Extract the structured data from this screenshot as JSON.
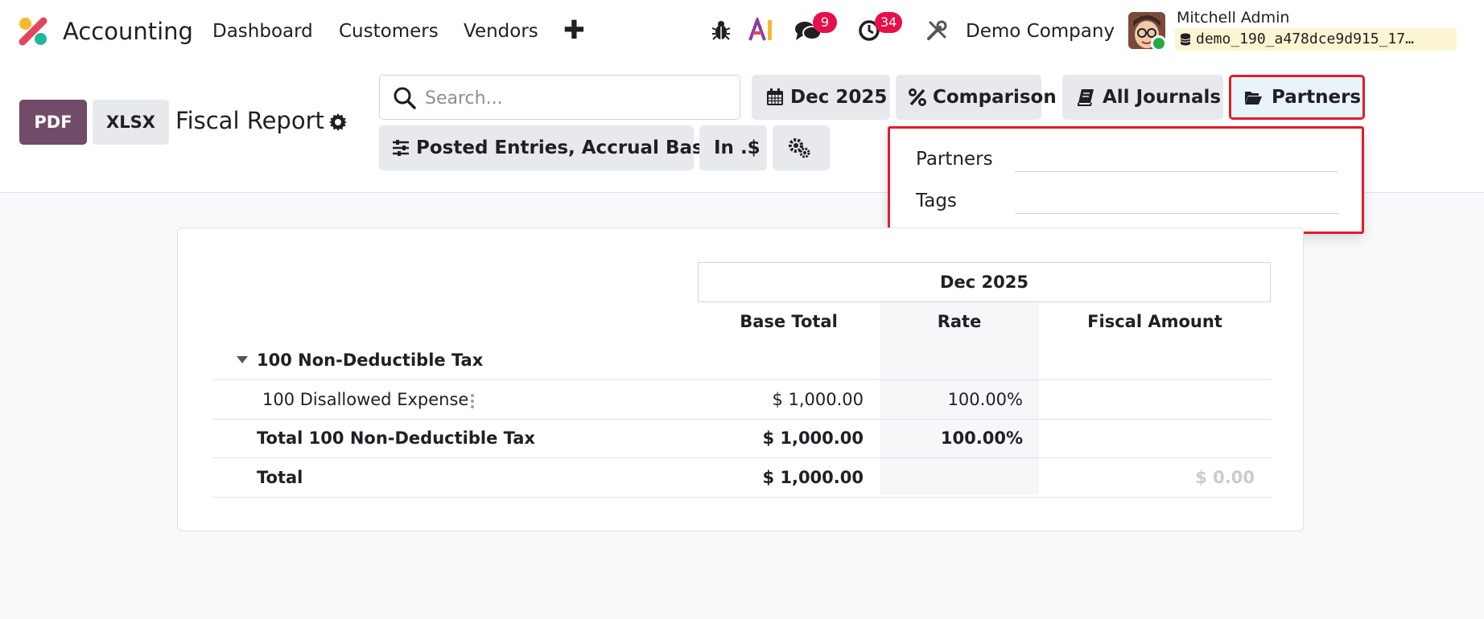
{
  "app": {
    "name": "Accounting"
  },
  "nav": {
    "items": [
      "Dashboard",
      "Customers",
      "Vendors"
    ]
  },
  "systray": {
    "messages_count": "9",
    "activities_count": "34",
    "company": "Demo Company",
    "user_name": "Mitchell Admin",
    "database": "demo_190_a478dce9d915_17…"
  },
  "toolbar": {
    "pdf_label": "PDF",
    "xlsx_label": "XLSX",
    "report_title": "Fiscal Report",
    "search_placeholder": "Search...",
    "date_filter": "Dec 2025",
    "comparison": "Comparison",
    "journals": "All Journals",
    "partners": "Partners",
    "entries_filter": "Posted Entries, Accrual Basis",
    "currency": "In .$"
  },
  "partner_dropdown": {
    "partners_label": "Partners",
    "tags_label": "Tags"
  },
  "report": {
    "period": "Dec 2025",
    "columns": [
      "Base Total",
      "Rate",
      "Fiscal Amount"
    ],
    "group": {
      "label": "100 Non-Deductible Tax"
    },
    "rows": [
      {
        "label": "100 Disallowed Expense",
        "base_total": "$ 1,000.00",
        "rate": "100.00%",
        "fiscal_amount": ""
      },
      {
        "label": "Total 100 Non-Deductible Tax",
        "base_total": "$ 1,000.00",
        "rate": "100.00%",
        "fiscal_amount": ""
      },
      {
        "label": "Total",
        "base_total": "$ 1,000.00",
        "rate": "",
        "fiscal_amount": "$ 0.00"
      }
    ]
  }
}
